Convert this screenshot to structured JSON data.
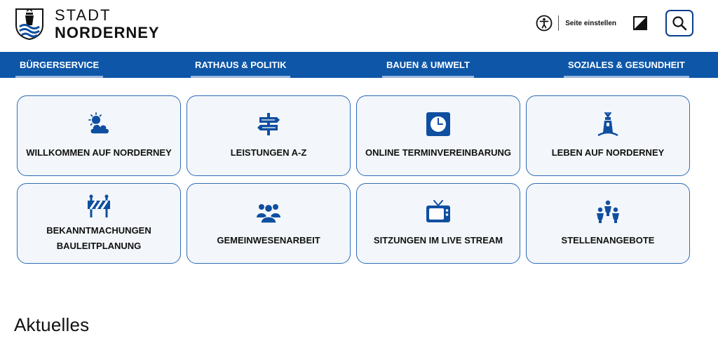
{
  "header": {
    "logo_line1": "STADT",
    "logo_line2": "NORDERNEY",
    "a11y_label": "Seite einstellen"
  },
  "nav": {
    "items": [
      {
        "label": "BÜRGERSERVICE"
      },
      {
        "label": "RATHAUS & POLITIK"
      },
      {
        "label": "BAUEN & UMWELT"
      },
      {
        "label": "SOZIALES & GESUNDHEIT"
      }
    ]
  },
  "tiles": [
    {
      "label": "WILLKOMMEN AUF NORDERNEY",
      "icon": "weather-icon"
    },
    {
      "label": "LEISTUNGEN A-Z",
      "icon": "signpost-icon"
    },
    {
      "label": "ONLINE TERMINVEREINBARUNG",
      "icon": "clock-icon"
    },
    {
      "label": "LEBEN AUF NORDERNEY",
      "icon": "lighthouse-icon"
    },
    {
      "label_line1": "BEKANNTMACHUNGEN",
      "label_line2": "BAULEITPLANUNG",
      "icon": "barrier-icon"
    },
    {
      "label": "GEMEINWESENARBEIT",
      "icon": "community-icon"
    },
    {
      "label": "SITZUNGEN IM LIVE STREAM",
      "icon": "tv-icon"
    },
    {
      "label": "STELLENANGEBOTE",
      "icon": "people-icon"
    }
  ],
  "section": {
    "title": "Aktuelles"
  },
  "colors": {
    "brand_blue": "#0d56a8",
    "icon_blue": "#0f4fa0",
    "tile_border": "#2d6cb5",
    "tile_bg": "#f3f6fa"
  }
}
